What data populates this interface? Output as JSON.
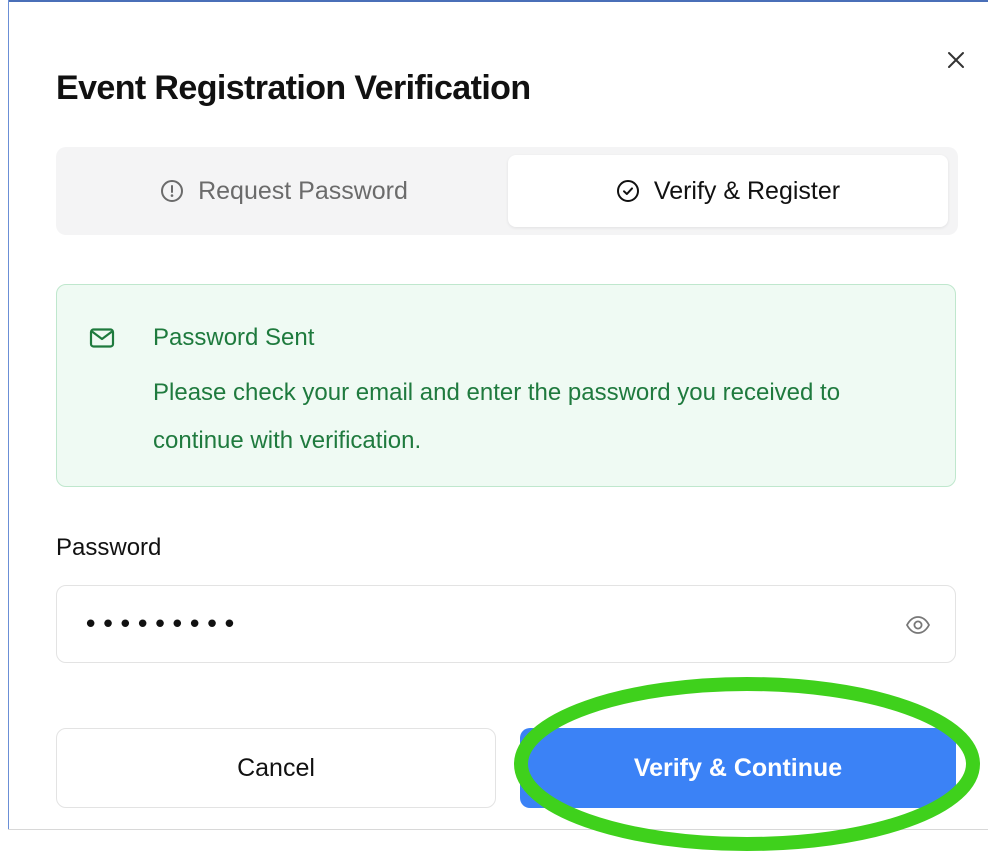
{
  "dialog": {
    "title": "Event Registration Verification",
    "close_symbol": "×"
  },
  "tabs": [
    {
      "label": "Request Password",
      "icon": "alert-circle-icon",
      "active": false
    },
    {
      "label": "Verify & Register",
      "icon": "check-circle-icon",
      "active": true
    }
  ],
  "alert": {
    "icon": "mail-icon",
    "title": "Password Sent",
    "message": "Please check your email and enter the password you received to continue with verification."
  },
  "password_field": {
    "label": "Password",
    "masked_value": "•••••••••",
    "toggle_icon": "eye-icon"
  },
  "actions": {
    "cancel_label": "Cancel",
    "verify_label": "Verify & Continue"
  },
  "annotation": {
    "shape": "ellipse",
    "color": "#3fd11c",
    "target": "verify-continue-button"
  },
  "colors": {
    "primary": "#3b82f6",
    "success_text": "#1e7a3d",
    "success_bg": "#effaf3",
    "success_border": "#bfe7cd",
    "tab_track": "#f4f4f5"
  }
}
